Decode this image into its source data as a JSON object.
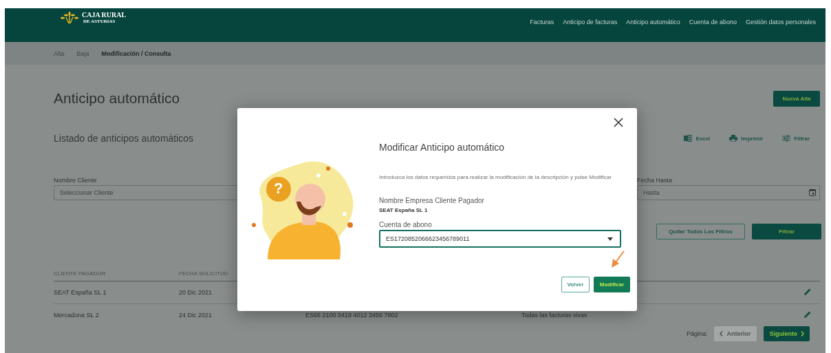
{
  "header": {
    "logo": {
      "title": "CAJA RURAL",
      "subtitle": "DE ASTURIAS"
    },
    "nav": [
      {
        "label": "Facturas"
      },
      {
        "label": "Anticipo de facturas"
      },
      {
        "label": "Anticipo automático"
      },
      {
        "label": "Cuenta de abono"
      },
      {
        "label": "Gestión datos personales"
      }
    ]
  },
  "subnav": [
    {
      "label": "Alta",
      "selected": false
    },
    {
      "label": "Baja",
      "selected": false
    },
    {
      "label": "Modificación / Consulta",
      "selected": true
    }
  ],
  "page": {
    "title": "Anticipo automático",
    "new_button": "Nueva Alta",
    "list_title": "Listado de anticipos automáticos",
    "tools": [
      {
        "kind": "excel",
        "label": "Excel"
      },
      {
        "kind": "print",
        "label": "Imprimir"
      },
      {
        "kind": "filter",
        "label": "Filtrar"
      }
    ],
    "filters": {
      "client": {
        "label": "Nombre Cliente",
        "placeholder": "Seleccionar Cliente"
      },
      "date_to": {
        "label": "Fecha Hasta",
        "placeholder": "Hasta"
      }
    },
    "clear_button": "Quitar Todos Los Filtros",
    "filter_button": "Filtrar"
  },
  "table": {
    "columns": [
      "CLIENTE PAGADOR",
      "FECHA SOLICITUD"
    ],
    "rows": [
      {
        "cells": [
          "SEAT España SL 1",
          "20 Dic 2021"
        ]
      },
      {
        "cells": [
          "Mercadona SL 2",
          "24 Dic 2021",
          "ES66 2100 0418 4012 3456 7802",
          "Todas las facturas vivas"
        ]
      }
    ]
  },
  "pagination": {
    "label": "Página:",
    "previous": {
      "label": "Anterior",
      "disabled": true
    },
    "next": {
      "label": "Siguiente",
      "disabled": false
    }
  },
  "modal": {
    "symbol": "?",
    "title": "Modificar Anticipo automático",
    "description": "Introduzca los datos requeridos para realizar la modificación de la descripción y pulse Modificar",
    "company_label": "Nombre Empresa Cliente Pagador",
    "company_value": "SEAT España SL 1",
    "account_label": "Cuenta de abono",
    "account_value": "ES1720852066623456789011",
    "buttons": [
      {
        "kind": "secondary",
        "label": "Volver"
      },
      {
        "kind": "primary",
        "label": "Modificar"
      }
    ]
  }
}
